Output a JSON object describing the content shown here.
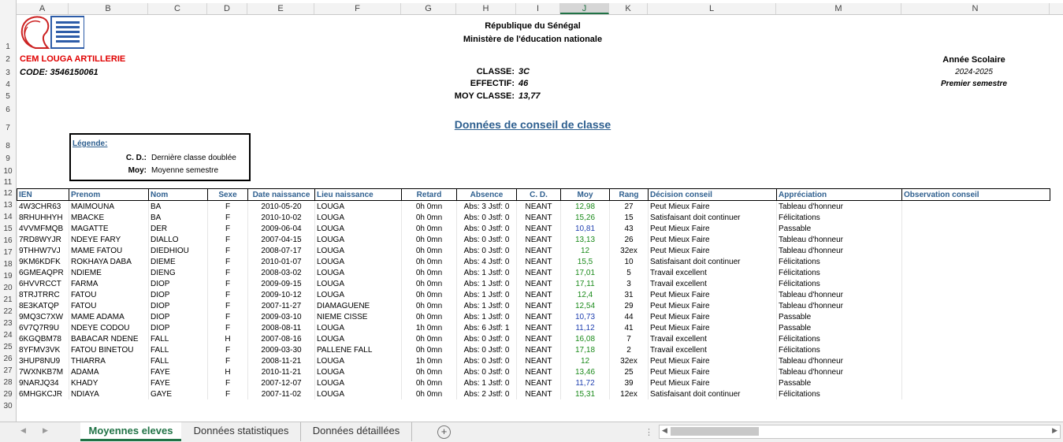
{
  "columns": [
    "A",
    "B",
    "C",
    "D",
    "E",
    "F",
    "G",
    "H",
    "I",
    "J",
    "K",
    "L",
    "M",
    "N"
  ],
  "selected_column": "J",
  "row_numbers": [
    "1",
    "2",
    "3",
    "4",
    "5",
    "6",
    "7",
    "8",
    "9",
    "10",
    "11",
    "12",
    "13",
    "14",
    "15",
    "16",
    "17",
    "18",
    "19",
    "20",
    "21",
    "22",
    "23",
    "24",
    "25",
    "26",
    "27",
    "28",
    "29",
    "30"
  ],
  "header": {
    "republic": "République du Sénégal",
    "ministry": "Ministère de l'éducation nationale",
    "school": "CEM LOUGA ARTILLERIE",
    "code": "CODE: 3546150061",
    "classe_label": "CLASSE:",
    "classe_value": "3C",
    "effectif_label": "EFFECTIF:",
    "effectif_value": "46",
    "moy_label": "MOY CLASSE:",
    "moy_value": "13,77",
    "year_label": "Année Scolaire",
    "year_value": "2024-2025",
    "semester": "Premier semestre",
    "title": "Données de conseil de classe"
  },
  "legend": {
    "title": "Légende:",
    "cd_key": "C. D.:",
    "cd_value": "Dernière classe doublée",
    "moy_key": "Moy:",
    "moy_value": "Moyenne semestre"
  },
  "table": {
    "headers": [
      "IEN",
      "Prenom",
      "Nom",
      "Sexe",
      "Date naissance",
      "Lieu naissance",
      "Retard",
      "Absence",
      "C. D.",
      "Moy",
      "Rang",
      "Décision conseil",
      "Appréciation",
      "Observation conseil"
    ],
    "rows": [
      [
        "4W3CHR63",
        "MAIMOUNA",
        "BA",
        "F",
        "2010-05-20",
        "LOUGA",
        "0h 0mn",
        "Abs: 3 Jstf: 0",
        "NEANT",
        "12,98",
        "27",
        "Peut Mieux Faire",
        "Tableau d'honneur",
        ""
      ],
      [
        "8RHUHHYH",
        "MBACKE",
        "BA",
        "F",
        "2010-10-02",
        "LOUGA",
        "0h 0mn",
        "Abs: 0 Jstf: 0",
        "NEANT",
        "15,26",
        "15",
        "Satisfaisant doit continuer",
        "Félicitations",
        ""
      ],
      [
        "4VVMFMQB",
        "MAGATTE",
        "DER",
        "F",
        "2009-06-04",
        "LOUGA",
        "0h 0mn",
        "Abs: 0 Jstf: 0",
        "NEANT",
        "10,81",
        "43",
        "Peut Mieux Faire",
        "Passable",
        ""
      ],
      [
        "7RD8WYJR",
        "NDEYE FARY",
        "DIALLO",
        "F",
        "2007-04-15",
        "LOUGA",
        "0h 0mn",
        "Abs: 0 Jstf: 0",
        "NEANT",
        "13,13",
        "26",
        "Peut Mieux Faire",
        "Tableau d'honneur",
        ""
      ],
      [
        "9THHW7VJ",
        "MAME FATOU",
        "DIEDHIOU",
        "F",
        "2008-07-17",
        "LOUGA",
        "0h 0mn",
        "Abs: 0 Jstf: 0",
        "NEANT",
        "12",
        "32ex",
        "Peut Mieux Faire",
        "Tableau d'honneur",
        ""
      ],
      [
        "9KM6KDFK",
        "ROKHAYA DABA",
        "DIEME",
        "F",
        "2010-01-07",
        "LOUGA",
        "0h 0mn",
        "Abs: 4 Jstf: 0",
        "NEANT",
        "15,5",
        "10",
        "Satisfaisant doit continuer",
        "Félicitations",
        ""
      ],
      [
        "6GMEAQPR",
        "NDIEME",
        "DIENG",
        "F",
        "2008-03-02",
        "LOUGA",
        "0h 0mn",
        "Abs: 1 Jstf: 0",
        "NEANT",
        "17,01",
        "5",
        "Travail excellent",
        "Félicitations",
        ""
      ],
      [
        "6HVVRCCT",
        "FARMA",
        "DIOP",
        "F",
        "2009-09-15",
        "LOUGA",
        "0h 0mn",
        "Abs: 1 Jstf: 0",
        "NEANT",
        "17,11",
        "3",
        "Travail excellent",
        "Félicitations",
        ""
      ],
      [
        "8TRJTRRC",
        "FATOU",
        "DIOP",
        "F",
        "2009-10-12",
        "LOUGA",
        "0h 0mn",
        "Abs: 1 Jstf: 0",
        "NEANT",
        "12,4",
        "31",
        "Peut Mieux Faire",
        "Tableau d'honneur",
        ""
      ],
      [
        "8E3KATQP",
        "FATOU",
        "DIOP",
        "F",
        "2007-11-27",
        "DIAMAGUENE",
        "0h 0mn",
        "Abs: 1 Jstf: 0",
        "NEANT",
        "12,54",
        "29",
        "Peut Mieux Faire",
        "Tableau d'honneur",
        ""
      ],
      [
        "9MQ3C7XW",
        "MAME ADAMA",
        "DIOP",
        "F",
        "2009-03-10",
        "NIEME CISSE",
        "0h 0mn",
        "Abs: 1 Jstf: 0",
        "NEANT",
        "10,73",
        "44",
        "Peut Mieux Faire",
        "Passable",
        ""
      ],
      [
        "6V7Q7R9U",
        "NDEYE CODOU",
        "DIOP",
        "F",
        "2008-08-11",
        "LOUGA",
        "1h 0mn",
        "Abs: 6 Jstf: 1",
        "NEANT",
        "11,12",
        "41",
        "Peut Mieux Faire",
        "Passable",
        ""
      ],
      [
        "6KGQBM78",
        "BABACAR NDENE",
        "FALL",
        "H",
        "2007-08-16",
        "LOUGA",
        "0h 0mn",
        "Abs: 0 Jstf: 0",
        "NEANT",
        "16,08",
        "7",
        "Travail excellent",
        "Félicitations",
        ""
      ],
      [
        "8YFMV3VK",
        "FATOU BINETOU",
        "FALL",
        "F",
        "2009-03-30",
        "PALLENE FALL",
        "0h 0mn",
        "Abs: 0 Jstf: 0",
        "NEANT",
        "17,18",
        "2",
        "Travail excellent",
        "Félicitations",
        ""
      ],
      [
        "3HUP8NU9",
        "THIARRA",
        "FALL",
        "F",
        "2008-11-21",
        "LOUGA",
        "1h 0mn",
        "Abs: 0 Jstf: 0",
        "NEANT",
        "12",
        "32ex",
        "Peut Mieux Faire",
        "Tableau d'honneur",
        ""
      ],
      [
        "7WXNKB7M",
        "ADAMA",
        "FAYE",
        "H",
        "2010-11-21",
        "LOUGA",
        "0h 0mn",
        "Abs: 0 Jstf: 0",
        "NEANT",
        "13,46",
        "25",
        "Peut Mieux Faire",
        "Tableau d'honneur",
        ""
      ],
      [
        "9NARJQ34",
        "KHADY",
        "FAYE",
        "F",
        "2007-12-07",
        "LOUGA",
        "0h 0mn",
        "Abs: 1 Jstf: 0",
        "NEANT",
        "11,72",
        "39",
        "Peut Mieux Faire",
        "Passable",
        ""
      ],
      [
        "6MHGKCJR",
        "NDIAYA",
        "GAYE",
        "F",
        "2007-11-02",
        "LOUGA",
        "0h 0mn",
        "Abs: 2 Jstf: 0",
        "NEANT",
        "15,31",
        "12ex",
        "Satisfaisant doit continuer",
        "Félicitations",
        ""
      ]
    ],
    "moy_colors": [
      "#1a8a1a",
      "#1a8a1a",
      "#1f3fb0",
      "#1a8a1a",
      "#1a8a1a",
      "#1a8a1a",
      "#1a8a1a",
      "#1a8a1a",
      "#1a8a1a",
      "#1a8a1a",
      "#1f3fb0",
      "#1f3fb0",
      "#1a8a1a",
      "#1a8a1a",
      "#1a8a1a",
      "#1a8a1a",
      "#1f3fb0",
      "#1a8a1a"
    ]
  },
  "tabs": [
    "Moyennes eleves",
    "Données statistiques",
    "Données détaillées"
  ],
  "active_tab": "Moyennes eleves",
  "add_sheet_symbol": "+",
  "accent_color": "#217346"
}
